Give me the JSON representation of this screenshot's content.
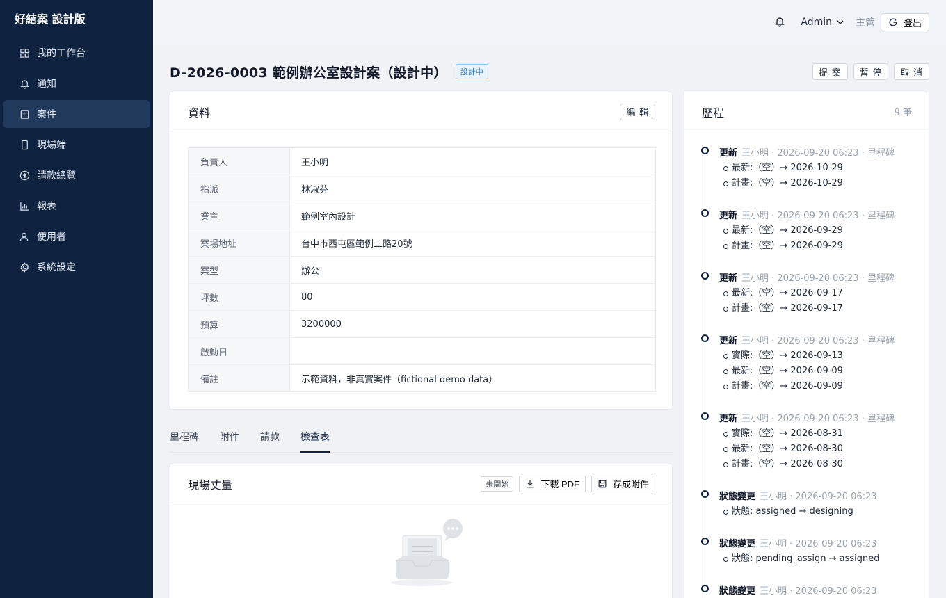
{
  "app": {
    "brand": "好結案 設計版"
  },
  "sidebar": {
    "items": [
      {
        "label": "我的工作台",
        "icon": "grid-icon"
      },
      {
        "label": "通知",
        "icon": "bell-icon"
      },
      {
        "label": "案件",
        "icon": "document-icon",
        "active": true
      },
      {
        "label": "現場端",
        "icon": "mobile-icon"
      },
      {
        "label": "請款總覽",
        "icon": "dollar-icon"
      },
      {
        "label": "報表",
        "icon": "bar-chart-icon"
      },
      {
        "label": "使用者",
        "icon": "user-icon"
      },
      {
        "label": "系統設定",
        "icon": "gear-icon"
      }
    ]
  },
  "header": {
    "user": "Admin",
    "role": "主管",
    "logout": "登出"
  },
  "page": {
    "title": "D-2026-0003 範例辦公室設計案（設計中）",
    "status": "設計中",
    "actions": {
      "propose": "提 案",
      "pause": "暫 停",
      "cancel": "取 消"
    }
  },
  "info": {
    "title": "資料",
    "edit": "編 輯",
    "rows": [
      {
        "k": "負責人",
        "v": "王小明"
      },
      {
        "k": "指派",
        "v": "林淑芬"
      },
      {
        "k": "業主",
        "v": "範例室內設計"
      },
      {
        "k": "案場地址",
        "v": "台中市西屯區範例二路20號"
      },
      {
        "k": "案型",
        "v": "辦公"
      },
      {
        "k": "坪數",
        "v": "80"
      },
      {
        "k": "預算",
        "v": "3200000"
      },
      {
        "k": "啟動日",
        "v": ""
      },
      {
        "k": "備註",
        "v": "示範資料，非真實案件（fictional demo data）"
      }
    ]
  },
  "tabs": [
    {
      "label": "里程碑"
    },
    {
      "label": "附件"
    },
    {
      "label": "請款"
    },
    {
      "label": "檢查表",
      "active": true
    }
  ],
  "checklist": {
    "title": "現場丈量",
    "status": "未開始",
    "download": "下載 PDF",
    "save": "存成附件"
  },
  "history": {
    "title": "歷程",
    "count": "9 筆",
    "entries": [
      {
        "type": "更新",
        "meta": "王小明 · 2026-09-20 06:23 · 里程碑",
        "changes": [
          "最新:（空）→ 2026-10-29",
          "計畫:（空）→ 2026-10-29"
        ]
      },
      {
        "type": "更新",
        "meta": "王小明 · 2026-09-20 06:23 · 里程碑",
        "changes": [
          "最新:（空）→ 2026-09-29",
          "計畫:（空）→ 2026-09-29"
        ]
      },
      {
        "type": "更新",
        "meta": "王小明 · 2026-09-20 06:23 · 里程碑",
        "changes": [
          "最新:（空）→ 2026-09-17",
          "計畫:（空）→ 2026-09-17"
        ]
      },
      {
        "type": "更新",
        "meta": "王小明 · 2026-09-20 06:23 · 里程碑",
        "changes": [
          "實際:（空）→ 2026-09-13",
          "最新:（空）→ 2026-09-09",
          "計畫:（空）→ 2026-09-09"
        ]
      },
      {
        "type": "更新",
        "meta": "王小明 · 2026-09-20 06:23 · 里程碑",
        "changes": [
          "實際:（空）→ 2026-08-31",
          "最新:（空）→ 2026-08-30",
          "計畫:（空）→ 2026-08-30"
        ]
      },
      {
        "type": "狀態變更",
        "meta": "王小明 · 2026-09-20 06:23",
        "changes": [
          "狀態: assigned → designing"
        ]
      },
      {
        "type": "狀態變更",
        "meta": "王小明 · 2026-09-20 06:23",
        "changes": [
          "狀態: pending_assign → assigned"
        ]
      },
      {
        "type": "狀態變更",
        "meta": "王小明 · 2026-09-20 06:23",
        "changes": []
      }
    ]
  }
}
